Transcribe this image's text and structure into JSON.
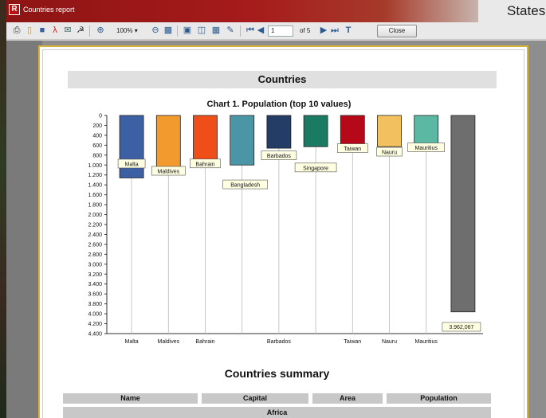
{
  "window": {
    "title": "Countries report",
    "background_text": "States"
  },
  "toolbar": {
    "zoom": "100%",
    "page_current": "1",
    "page_of": "of 5",
    "close_label": "Close"
  },
  "report": {
    "heading": "Countries",
    "summary_title": "Countries summary",
    "table_headers": [
      "Name",
      "Capital",
      "Area",
      "Population"
    ],
    "region": "Africa"
  },
  "chart_data": {
    "type": "bar",
    "title": "Chart 1. Population (top 10 values)",
    "categories": [
      "Malta",
      "Maldives",
      "Bahrain",
      "Bangladesh",
      "Barbados",
      "Singapore",
      "Taiwan",
      "Nauru",
      "Mauritius",
      ""
    ],
    "values": [
      1260,
      1160,
      1040,
      1000,
      660,
      630,
      660,
      630,
      600,
      3962.067
    ],
    "colors": [
      "#3d5fa3",
      "#f29a2e",
      "#ef4e19",
      "#4a95a6",
      "#243d66",
      "#1b7a62",
      "#b5091a",
      "#f3c060",
      "#5bb8a2",
      "#6e6e6e"
    ],
    "y_axis_ticks": [
      "0",
      "200",
      "400",
      "600",
      "800",
      "1.000",
      "1.200",
      "1.400",
      "1.600",
      "1.800",
      "2.000",
      "2.200",
      "2.400",
      "2.600",
      "2.800",
      "3.000",
      "3.200",
      "3.400",
      "3.600",
      "3.800",
      "4.000",
      "4.200",
      "4.400"
    ],
    "ylim": [
      0,
      4400
    ],
    "y_inverted": true,
    "x_tick_labels": [
      "Malta",
      "Maldives",
      "Bahrain",
      "Barbados",
      "Taiwan",
      "Nauru",
      "Mauritius"
    ],
    "value_label": "3.962,067"
  }
}
